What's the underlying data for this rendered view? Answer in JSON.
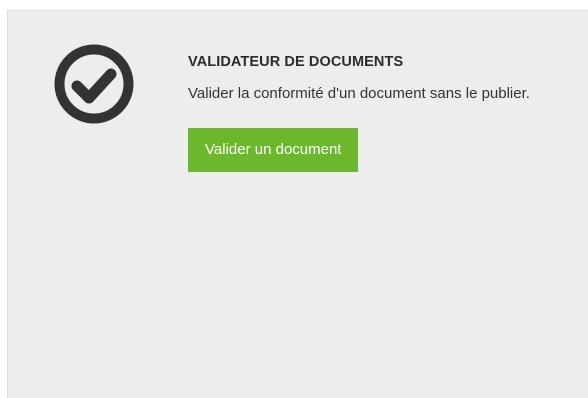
{
  "card": {
    "icon": "check-circle-icon",
    "title": "VALIDATEUR DE DOCUMENTS",
    "description": "Valider la conformité d'un document sans le publier.",
    "button_label": "Valider un document"
  },
  "colors": {
    "card_background": "#ededed",
    "icon": "#333333",
    "button_background": "#6cb82c",
    "button_text": "#ffffff"
  }
}
